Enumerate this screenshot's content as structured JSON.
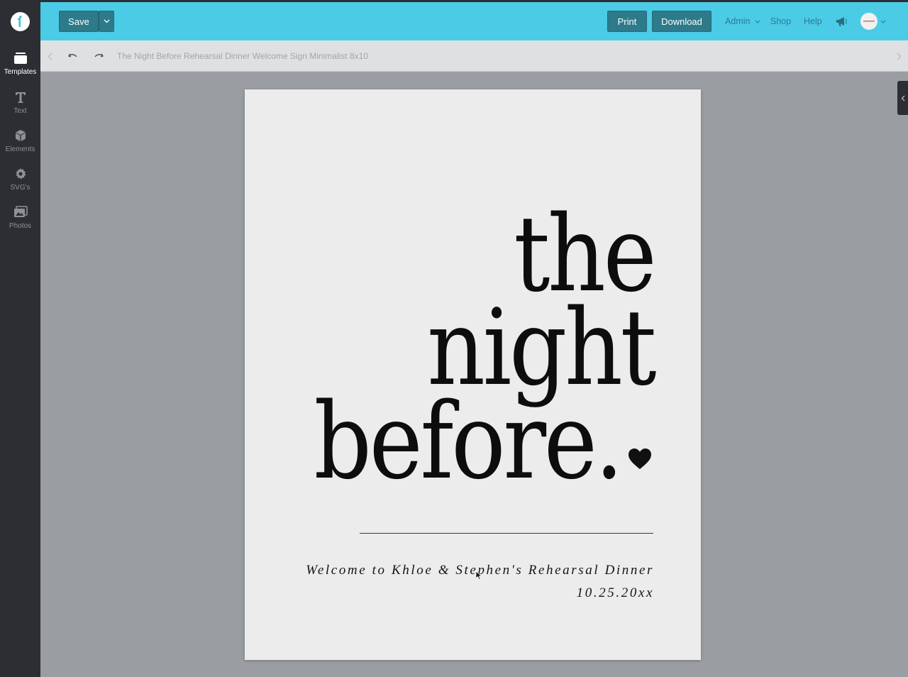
{
  "sidebar": {
    "items": [
      {
        "label": "Templates",
        "icon": "templates-icon"
      },
      {
        "label": "Text",
        "icon": "text-icon"
      },
      {
        "label": "Elements",
        "icon": "cube-icon"
      },
      {
        "label": "SVG's",
        "icon": "gear-icon"
      },
      {
        "label": "Photos",
        "icon": "photos-icon"
      }
    ]
  },
  "header": {
    "save_label": "Save",
    "print_label": "Print",
    "download_label": "Download",
    "admin_label": "Admin",
    "shop_label": "Shop",
    "help_label": "Help",
    "accent_color": "#4ccbe6",
    "button_color": "#2d7a8a"
  },
  "toolbar": {
    "document_title": "The Night Before Rehearsal Dinner Welcome Sign Minimalist 8x10"
  },
  "canvas": {
    "line1": "the",
    "line2": "night",
    "line3": "before.",
    "welcome": "Welcome to Khloe & Stephen's Rehearsal Dinner",
    "date": "10.25.20xx"
  }
}
